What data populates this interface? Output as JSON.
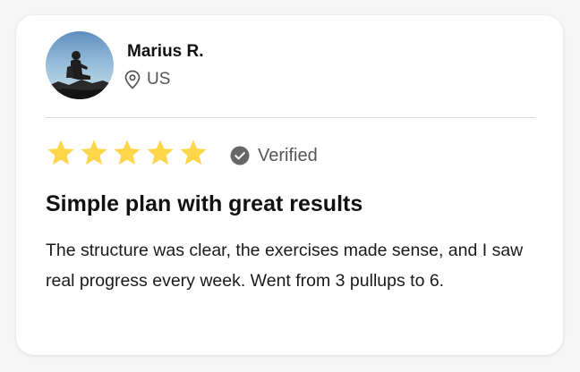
{
  "review": {
    "reviewer_name": "Marius R.",
    "location": "US",
    "rating": 5,
    "rating_max": 5,
    "verified_label": "Verified",
    "title": "Simple plan with great results",
    "body": "The structure was clear, the exercises made sense, and I saw real progress every week. Went from 3 pullups to 6."
  },
  "icons": {
    "location": "map-pin-icon",
    "star": "star-icon",
    "verified": "check-circle-icon"
  },
  "colors": {
    "star": "#FFD54A",
    "verified_badge": "#666666",
    "divider": "#D9D9D9",
    "card_background": "#FFFFFF"
  }
}
